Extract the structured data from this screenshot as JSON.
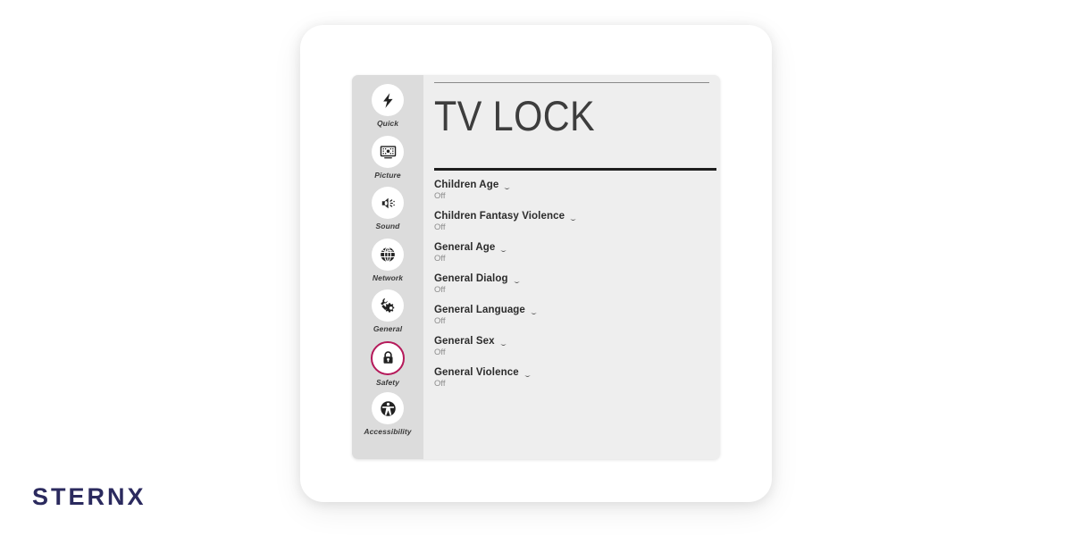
{
  "brand": {
    "logo_text": "STERNX"
  },
  "colors": {
    "accent": "#b5195a",
    "panel_background": "#eeeeee",
    "sidebar_background": "#dcdcdc",
    "title_text": "#3d3d3d",
    "label_text": "#2b2b2b",
    "value_text": "#8c8c8c",
    "brand_navy": "#2b2a5e"
  },
  "sidebar": {
    "items": [
      {
        "label": "Quick",
        "icon": "lightning-bolt-icon",
        "active": false
      },
      {
        "label": "Picture",
        "icon": "tv-screen-icon",
        "active": false
      },
      {
        "label": "Sound",
        "icon": "speaker-icon",
        "active": false
      },
      {
        "label": "Network",
        "icon": "globe-icon",
        "active": false
      },
      {
        "label": "General",
        "icon": "wrench-gear-icon",
        "active": false
      },
      {
        "label": "Safety",
        "icon": "padlock-icon",
        "active": true
      },
      {
        "label": "Accessibility",
        "icon": "accessibility-icon",
        "active": false
      }
    ]
  },
  "content": {
    "title": "TV LOCK",
    "settings": [
      {
        "label": "Children Age",
        "value": "Off",
        "control": "chevron-down-icon"
      },
      {
        "label": "Children Fantasy Violence",
        "value": "Off",
        "control": "chevron-down-icon"
      },
      {
        "label": "General Age",
        "value": "Off",
        "control": "chevron-down-icon"
      },
      {
        "label": "General Dialog",
        "value": "Off",
        "control": "chevron-down-icon"
      },
      {
        "label": "General Language",
        "value": "Off",
        "control": "chevron-down-icon"
      },
      {
        "label": "General Sex",
        "value": "Off",
        "control": "chevron-down-icon"
      },
      {
        "label": "General Violence",
        "value": "Off",
        "control": "chevron-down-icon"
      }
    ]
  }
}
